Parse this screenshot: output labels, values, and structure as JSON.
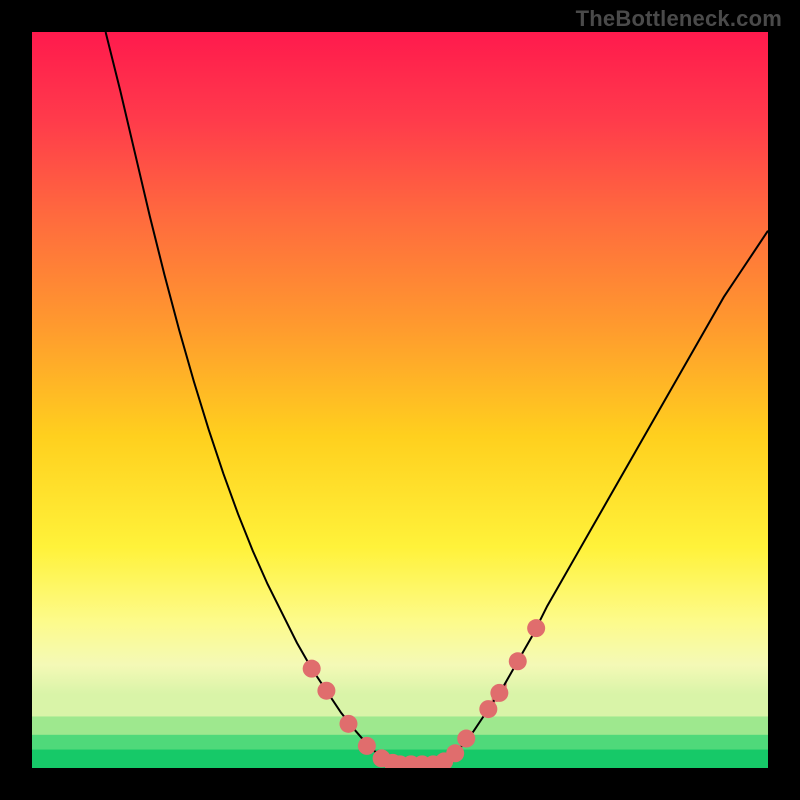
{
  "watermark": "TheBottleneck.com",
  "chart_data": {
    "type": "line",
    "title": "",
    "xlabel": "",
    "ylabel": "",
    "xlim": [
      0,
      100
    ],
    "ylim": [
      0,
      100
    ],
    "curve": {
      "name": "bottleneck-curve",
      "color": "#000000",
      "stroke_width": 2,
      "points": [
        {
          "x": 10.0,
          "y": 100.0
        },
        {
          "x": 12.0,
          "y": 92.0
        },
        {
          "x": 14.0,
          "y": 83.5
        },
        {
          "x": 16.0,
          "y": 75.0
        },
        {
          "x": 18.0,
          "y": 67.0
        },
        {
          "x": 20.0,
          "y": 59.5
        },
        {
          "x": 22.0,
          "y": 52.5
        },
        {
          "x": 24.0,
          "y": 46.0
        },
        {
          "x": 26.0,
          "y": 40.0
        },
        {
          "x": 28.0,
          "y": 34.5
        },
        {
          "x": 30.0,
          "y": 29.5
        },
        {
          "x": 32.0,
          "y": 25.0
        },
        {
          "x": 34.0,
          "y": 21.0
        },
        {
          "x": 36.0,
          "y": 17.0
        },
        {
          "x": 38.0,
          "y": 13.5
        },
        {
          "x": 40.0,
          "y": 10.5
        },
        {
          "x": 42.0,
          "y": 7.5
        },
        {
          "x": 44.0,
          "y": 5.0
        },
        {
          "x": 46.0,
          "y": 2.7
        },
        {
          "x": 48.0,
          "y": 1.2
        },
        {
          "x": 49.0,
          "y": 0.7
        },
        {
          "x": 50.0,
          "y": 0.5
        },
        {
          "x": 51.0,
          "y": 0.5
        },
        {
          "x": 52.0,
          "y": 0.5
        },
        {
          "x": 53.0,
          "y": 0.5
        },
        {
          "x": 54.0,
          "y": 0.5
        },
        {
          "x": 55.0,
          "y": 0.6
        },
        {
          "x": 56.0,
          "y": 0.9
        },
        {
          "x": 57.0,
          "y": 1.5
        },
        {
          "x": 58.0,
          "y": 2.5
        },
        {
          "x": 60.0,
          "y": 5.0
        },
        {
          "x": 62.0,
          "y": 8.0
        },
        {
          "x": 64.0,
          "y": 11.0
        },
        {
          "x": 66.0,
          "y": 14.5
        },
        {
          "x": 68.0,
          "y": 18.0
        },
        {
          "x": 70.0,
          "y": 22.0
        },
        {
          "x": 72.0,
          "y": 25.5
        },
        {
          "x": 74.0,
          "y": 29.0
        },
        {
          "x": 76.0,
          "y": 32.5
        },
        {
          "x": 78.0,
          "y": 36.0
        },
        {
          "x": 80.0,
          "y": 39.5
        },
        {
          "x": 82.0,
          "y": 43.0
        },
        {
          "x": 84.0,
          "y": 46.5
        },
        {
          "x": 86.0,
          "y": 50.0
        },
        {
          "x": 88.0,
          "y": 53.5
        },
        {
          "x": 90.0,
          "y": 57.0
        },
        {
          "x": 92.0,
          "y": 60.5
        },
        {
          "x": 94.0,
          "y": 64.0
        },
        {
          "x": 96.0,
          "y": 67.0
        },
        {
          "x": 98.0,
          "y": 70.0
        },
        {
          "x": 100.0,
          "y": 73.0
        }
      ]
    },
    "markers": {
      "name": "highlight-points",
      "color": "#e06d6d",
      "radius": 9,
      "points": [
        {
          "x": 38.0,
          "y": 13.5
        },
        {
          "x": 40.0,
          "y": 10.5
        },
        {
          "x": 43.0,
          "y": 6.0
        },
        {
          "x": 45.5,
          "y": 3.0
        },
        {
          "x": 47.5,
          "y": 1.3
        },
        {
          "x": 49.0,
          "y": 0.7
        },
        {
          "x": 50.0,
          "y": 0.5
        },
        {
          "x": 51.5,
          "y": 0.5
        },
        {
          "x": 53.0,
          "y": 0.5
        },
        {
          "x": 54.5,
          "y": 0.5
        },
        {
          "x": 56.0,
          "y": 0.9
        },
        {
          "x": 57.5,
          "y": 2.0
        },
        {
          "x": 59.0,
          "y": 4.0
        },
        {
          "x": 62.0,
          "y": 8.0
        },
        {
          "x": 63.5,
          "y": 10.2
        },
        {
          "x": 66.0,
          "y": 14.5
        },
        {
          "x": 68.5,
          "y": 19.0
        }
      ]
    },
    "gradient_stops": [
      {
        "offset": 0.0,
        "color": "#ff1a4d"
      },
      {
        "offset": 0.12,
        "color": "#ff3b4b"
      },
      {
        "offset": 0.25,
        "color": "#ff6a3e"
      },
      {
        "offset": 0.4,
        "color": "#ff9a2e"
      },
      {
        "offset": 0.55,
        "color": "#ffd01e"
      },
      {
        "offset": 0.7,
        "color": "#fff23a"
      },
      {
        "offset": 0.8,
        "color": "#fdfb8a"
      },
      {
        "offset": 0.86,
        "color": "#f4f9b6"
      },
      {
        "offset": 0.9,
        "color": "#d9f4a8"
      },
      {
        "offset": 0.93,
        "color": "#9ee88e"
      },
      {
        "offset": 0.96,
        "color": "#4fd97a"
      },
      {
        "offset": 1.0,
        "color": "#16c968"
      }
    ],
    "green_bands": [
      {
        "y0": 0.9,
        "y1": 0.93,
        "color": "#d9f4a8"
      },
      {
        "y0": 0.93,
        "y1": 0.955,
        "color": "#9ee88e"
      },
      {
        "y0": 0.955,
        "y1": 0.975,
        "color": "#4fd97a"
      },
      {
        "y0": 0.975,
        "y1": 1.0,
        "color": "#16c968"
      }
    ],
    "noise_band": {
      "x0": 62.5,
      "x1": 64.5,
      "amplitude": 1.2,
      "color": "#e06d6d"
    }
  }
}
